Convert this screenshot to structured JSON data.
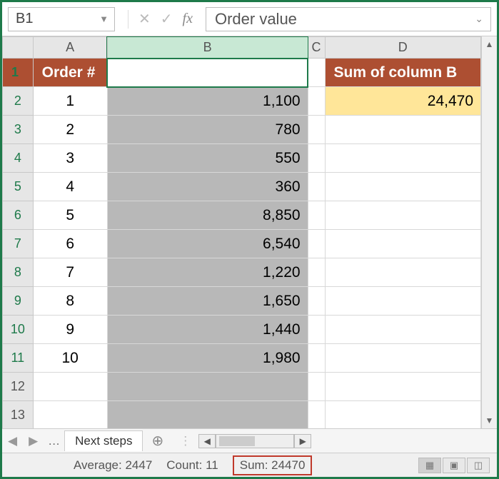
{
  "formula_bar": {
    "name_box": "B1",
    "formula_value": "Order value"
  },
  "columns": {
    "A": "A",
    "B": "B",
    "C": "C",
    "D": "D"
  },
  "headers": {
    "orderNum": "Order #",
    "orderValue": "Order value",
    "sumB": "Sum of column B"
  },
  "sumValue": "24,470",
  "rows": [
    {
      "n": "1",
      "v": "1,100"
    },
    {
      "n": "2",
      "v": "780"
    },
    {
      "n": "3",
      "v": "550"
    },
    {
      "n": "4",
      "v": "360"
    },
    {
      "n": "5",
      "v": "8,850"
    },
    {
      "n": "6",
      "v": "6,540"
    },
    {
      "n": "7",
      "v": "1,220"
    },
    {
      "n": "8",
      "v": "1,650"
    },
    {
      "n": "9",
      "v": "1,440"
    },
    {
      "n": "10",
      "v": "1,980"
    }
  ],
  "rowlabels": [
    "1",
    "2",
    "3",
    "4",
    "5",
    "6",
    "7",
    "8",
    "9",
    "10",
    "11",
    "12",
    "13"
  ],
  "sheet_tab": "Next steps",
  "status": {
    "avg_label": "Average: 2447",
    "count_label": "Count: 11",
    "sum_label": "Sum: 24470"
  }
}
